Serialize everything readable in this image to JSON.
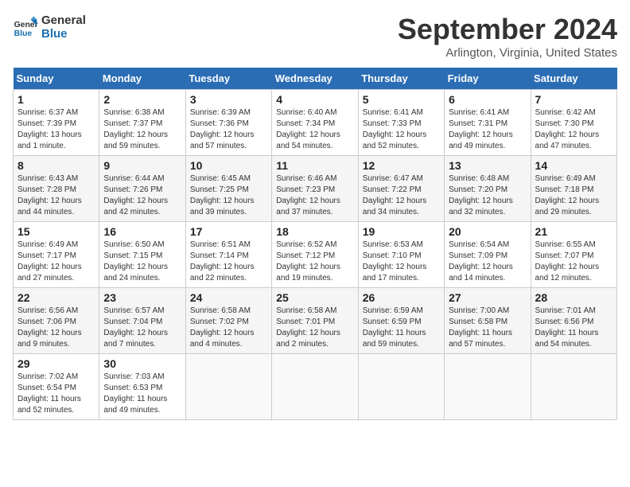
{
  "logo": {
    "line1": "General",
    "line2": "Blue"
  },
  "title": "September 2024",
  "location": "Arlington, Virginia, United States",
  "headers": [
    "Sunday",
    "Monday",
    "Tuesday",
    "Wednesday",
    "Thursday",
    "Friday",
    "Saturday"
  ],
  "weeks": [
    [
      {
        "day": "1",
        "info": "Sunrise: 6:37 AM\nSunset: 7:39 PM\nDaylight: 13 hours\nand 1 minute."
      },
      {
        "day": "2",
        "info": "Sunrise: 6:38 AM\nSunset: 7:37 PM\nDaylight: 12 hours\nand 59 minutes."
      },
      {
        "day": "3",
        "info": "Sunrise: 6:39 AM\nSunset: 7:36 PM\nDaylight: 12 hours\nand 57 minutes."
      },
      {
        "day": "4",
        "info": "Sunrise: 6:40 AM\nSunset: 7:34 PM\nDaylight: 12 hours\nand 54 minutes."
      },
      {
        "day": "5",
        "info": "Sunrise: 6:41 AM\nSunset: 7:33 PM\nDaylight: 12 hours\nand 52 minutes."
      },
      {
        "day": "6",
        "info": "Sunrise: 6:41 AM\nSunset: 7:31 PM\nDaylight: 12 hours\nand 49 minutes."
      },
      {
        "day": "7",
        "info": "Sunrise: 6:42 AM\nSunset: 7:30 PM\nDaylight: 12 hours\nand 47 minutes."
      }
    ],
    [
      {
        "day": "8",
        "info": "Sunrise: 6:43 AM\nSunset: 7:28 PM\nDaylight: 12 hours\nand 44 minutes."
      },
      {
        "day": "9",
        "info": "Sunrise: 6:44 AM\nSunset: 7:26 PM\nDaylight: 12 hours\nand 42 minutes."
      },
      {
        "day": "10",
        "info": "Sunrise: 6:45 AM\nSunset: 7:25 PM\nDaylight: 12 hours\nand 39 minutes."
      },
      {
        "day": "11",
        "info": "Sunrise: 6:46 AM\nSunset: 7:23 PM\nDaylight: 12 hours\nand 37 minutes."
      },
      {
        "day": "12",
        "info": "Sunrise: 6:47 AM\nSunset: 7:22 PM\nDaylight: 12 hours\nand 34 minutes."
      },
      {
        "day": "13",
        "info": "Sunrise: 6:48 AM\nSunset: 7:20 PM\nDaylight: 12 hours\nand 32 minutes."
      },
      {
        "day": "14",
        "info": "Sunrise: 6:49 AM\nSunset: 7:18 PM\nDaylight: 12 hours\nand 29 minutes."
      }
    ],
    [
      {
        "day": "15",
        "info": "Sunrise: 6:49 AM\nSunset: 7:17 PM\nDaylight: 12 hours\nand 27 minutes."
      },
      {
        "day": "16",
        "info": "Sunrise: 6:50 AM\nSunset: 7:15 PM\nDaylight: 12 hours\nand 24 minutes."
      },
      {
        "day": "17",
        "info": "Sunrise: 6:51 AM\nSunset: 7:14 PM\nDaylight: 12 hours\nand 22 minutes."
      },
      {
        "day": "18",
        "info": "Sunrise: 6:52 AM\nSunset: 7:12 PM\nDaylight: 12 hours\nand 19 minutes."
      },
      {
        "day": "19",
        "info": "Sunrise: 6:53 AM\nSunset: 7:10 PM\nDaylight: 12 hours\nand 17 minutes."
      },
      {
        "day": "20",
        "info": "Sunrise: 6:54 AM\nSunset: 7:09 PM\nDaylight: 12 hours\nand 14 minutes."
      },
      {
        "day": "21",
        "info": "Sunrise: 6:55 AM\nSunset: 7:07 PM\nDaylight: 12 hours\nand 12 minutes."
      }
    ],
    [
      {
        "day": "22",
        "info": "Sunrise: 6:56 AM\nSunset: 7:06 PM\nDaylight: 12 hours\nand 9 minutes."
      },
      {
        "day": "23",
        "info": "Sunrise: 6:57 AM\nSunset: 7:04 PM\nDaylight: 12 hours\nand 7 minutes."
      },
      {
        "day": "24",
        "info": "Sunrise: 6:58 AM\nSunset: 7:02 PM\nDaylight: 12 hours\nand 4 minutes."
      },
      {
        "day": "25",
        "info": "Sunrise: 6:58 AM\nSunset: 7:01 PM\nDaylight: 12 hours\nand 2 minutes."
      },
      {
        "day": "26",
        "info": "Sunrise: 6:59 AM\nSunset: 6:59 PM\nDaylight: 11 hours\nand 59 minutes."
      },
      {
        "day": "27",
        "info": "Sunrise: 7:00 AM\nSunset: 6:58 PM\nDaylight: 11 hours\nand 57 minutes."
      },
      {
        "day": "28",
        "info": "Sunrise: 7:01 AM\nSunset: 6:56 PM\nDaylight: 11 hours\nand 54 minutes."
      }
    ],
    [
      {
        "day": "29",
        "info": "Sunrise: 7:02 AM\nSunset: 6:54 PM\nDaylight: 11 hours\nand 52 minutes."
      },
      {
        "day": "30",
        "info": "Sunrise: 7:03 AM\nSunset: 6:53 PM\nDaylight: 11 hours\nand 49 minutes."
      },
      {
        "day": "",
        "info": ""
      },
      {
        "day": "",
        "info": ""
      },
      {
        "day": "",
        "info": ""
      },
      {
        "day": "",
        "info": ""
      },
      {
        "day": "",
        "info": ""
      }
    ]
  ]
}
